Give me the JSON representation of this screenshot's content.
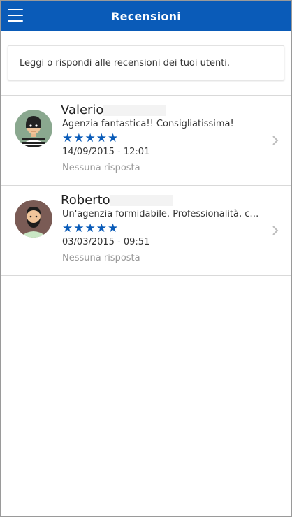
{
  "header": {
    "title": "Recensioni",
    "menu_icon": "hamburger-icon",
    "color": "#0a5bb8"
  },
  "info": {
    "text": "Leggi o rispondi alle recensioni dei tuoi utenti."
  },
  "reviews": [
    {
      "name": "Valerio",
      "message": "Agenzia fantastica!! Consigliatissima!",
      "rating": 5,
      "stars": "★★★★★",
      "datetime": "14/09/2015 - 12:01",
      "reply_status": "Nessuna risposta",
      "avatar_icon": "robber-avatar-icon"
    },
    {
      "name": "Roberto",
      "message": "Un'agenzia formidabile. Professionalità, cor...",
      "rating": 5,
      "stars": "★★★★★",
      "datetime": "03/03/2015 - 09:51",
      "reply_status": "Nessuna risposta",
      "avatar_icon": "bearded-man-avatar-icon"
    }
  ]
}
